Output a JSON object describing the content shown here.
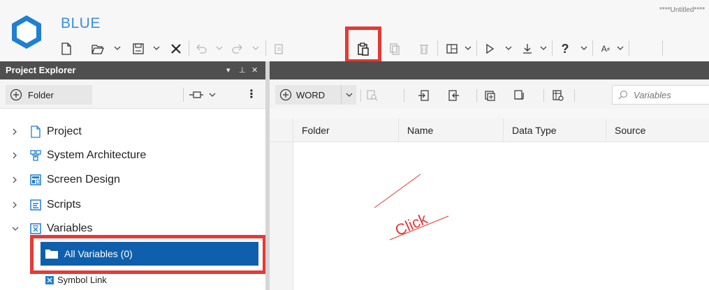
{
  "app": {
    "name": "BLUE",
    "doc_title": "****Untitled****"
  },
  "toolbar": {
    "items": [
      "new-file",
      "open",
      "save",
      "close",
      "undo",
      "redo",
      "copy",
      "paste",
      "cut",
      "delete",
      "layout",
      "run",
      "download",
      "help",
      "font"
    ]
  },
  "project_explorer": {
    "title": "Project Explorer",
    "pin_label": "▾ ⊥ ✕",
    "folder_button": "Folder",
    "tree": [
      {
        "label": "Project",
        "expanded": false
      },
      {
        "label": "System Architecture",
        "expanded": false
      },
      {
        "label": "Screen Design",
        "expanded": false
      },
      {
        "label": "Scripts",
        "expanded": false
      },
      {
        "label": "Variables",
        "expanded": true
      }
    ],
    "selected_item": "All Variables (0)",
    "child_item": "Symbol Link"
  },
  "variables_panel": {
    "word_button": "WORD",
    "search_placeholder": "Variables",
    "columns": [
      "Folder",
      "Name",
      "Data Type",
      "Source"
    ]
  },
  "annotation": {
    "text": "Click",
    "color": "#e53935"
  },
  "colors": {
    "accent": "#3a8fd8",
    "selection": "#0f5fad",
    "highlight": "#e53935",
    "header": "#4f4f4f"
  }
}
